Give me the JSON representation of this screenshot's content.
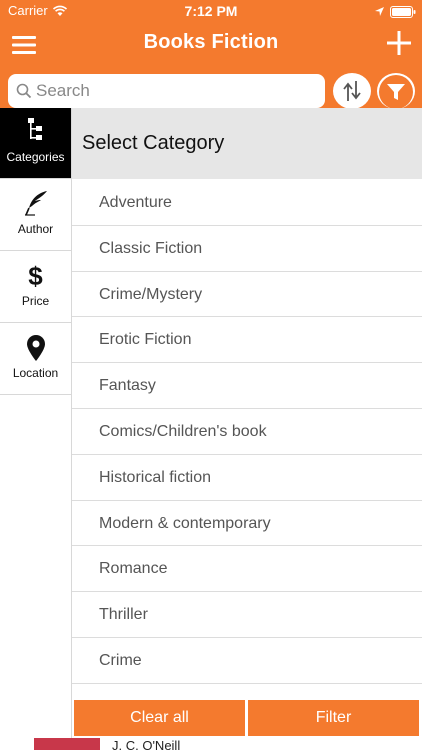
{
  "status_bar": {
    "carrier": "Carrier",
    "time": "7:12 PM"
  },
  "nav": {
    "title": "Books Fiction",
    "menu_icon": "hamburger-menu-icon",
    "add_icon": "plus-icon"
  },
  "search": {
    "placeholder": "Search",
    "value": ""
  },
  "colors": {
    "accent": "#f47a2e",
    "active_tab": "#000000",
    "header_bg": "#e6e6e6"
  },
  "sidebar": {
    "items": [
      {
        "label": "Categories",
        "icon": "category-tree-icon",
        "active": true
      },
      {
        "label": "Author",
        "icon": "quill-pen-icon",
        "active": false
      },
      {
        "label": "Price",
        "icon": "dollar-icon",
        "active": false
      },
      {
        "label": "Location",
        "icon": "location-pin-icon",
        "active": false
      }
    ]
  },
  "panel": {
    "title": "Select Category",
    "categories": [
      "Adventure",
      "Classic Fiction",
      "Crime/Mystery",
      "Erotic Fiction",
      "Fantasy",
      "Comics/Children's book",
      "Historical fiction",
      "Modern & contemporary",
      "Romance",
      "Thriller",
      "Crime"
    ]
  },
  "buttons": {
    "clear": "Clear all",
    "filter": "Filter"
  },
  "peek_text": "J. C. O'Neill"
}
